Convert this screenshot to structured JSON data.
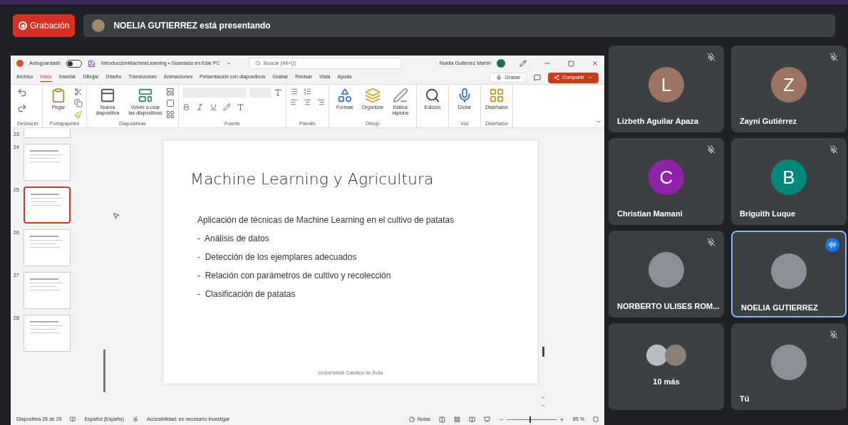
{
  "recording": {
    "label": "Grabación"
  },
  "presenter_bar": {
    "text": "NOELIA GUTIERREZ está presentando"
  },
  "powerpoint": {
    "autosave": {
      "label": "Autoguardado",
      "on": false
    },
    "doc_title": "IntroducciónMachineLearning • Guardado en Este PC",
    "search_placeholder": "Buscar (Alt+Q)",
    "user": "Noelia Gutiérrez Martín",
    "tabs": [
      {
        "label": "Archivo",
        "selected": false
      },
      {
        "label": "Inicio",
        "selected": true
      },
      {
        "label": "Insertar",
        "selected": false
      },
      {
        "label": "Dibujar",
        "selected": false
      },
      {
        "label": "Diseño",
        "selected": false
      },
      {
        "label": "Transiciones",
        "selected": false
      },
      {
        "label": "Animaciones",
        "selected": false
      },
      {
        "label": "Presentación con diapositivos",
        "selected": false
      },
      {
        "label": "Grabar",
        "selected": false
      },
      {
        "label": "Revisar",
        "selected": false
      },
      {
        "label": "Vista",
        "selected": false
      },
      {
        "label": "Ayuda",
        "selected": false
      }
    ],
    "record_button": "Grabar",
    "share_button": "Compartir",
    "ribbon_groups": [
      {
        "label": "Deshacer",
        "kind": "undo"
      },
      {
        "label": "Portapapeles",
        "kind": "clipboard",
        "buttons": [
          "Pegar"
        ]
      },
      {
        "label": "Diapositivas",
        "kind": "slides",
        "buttons": [
          "Nueva diapositiva",
          "Volver a usar las diapositivas"
        ]
      },
      {
        "label": "Fuente",
        "kind": "font"
      },
      {
        "label": "Párrafo",
        "kind": "paragraph"
      },
      {
        "label": "Dibujo",
        "kind": "drawing",
        "buttons": [
          "Formas",
          "Organizar",
          "Estilos rápidos"
        ]
      },
      {
        "kind": "editing",
        "buttons": [
          "Edición"
        ]
      },
      {
        "label": "Voz",
        "kind": "voice",
        "buttons": [
          "Dictar"
        ]
      },
      {
        "label": "Diseñador",
        "kind": "designer",
        "buttons": [
          "Diseñador"
        ]
      }
    ],
    "thumbnails": [
      {
        "number": "23",
        "selected": false
      },
      {
        "number": "24",
        "selected": false
      },
      {
        "number": "25",
        "selected": true
      },
      {
        "number": "26",
        "selected": false
      },
      {
        "number": "27",
        "selected": false
      },
      {
        "number": "28",
        "selected": false
      }
    ],
    "slide": {
      "title": "Machine Learning y Agricultura",
      "subtitle": "Aplicación de técnicas de Machine Learning en el cultivo de patatas",
      "bullets": [
        "-  Análisis de datos",
        "-  Detección de los ejemplares adecuados",
        "-  Relación con parámetros de cultivo y recolección",
        "-  Clasificación de patatas"
      ],
      "footer": "Universidad Católica de Ávila"
    },
    "status_bar": {
      "slide_count": "Diapositiva 25 de 29",
      "language": "Español (España)",
      "accessibility": "Accesibilidad: es necesario investigar",
      "notes": "Notas",
      "zoom": "85 %",
      "zoom_slider": {
        "level": 0.45
      }
    }
  },
  "participants": [
    {
      "name": "Lizbeth Aguilar Apaza",
      "kind": "letter",
      "letter": "L",
      "color": "#9c7461",
      "muted": true,
      "speaking": false
    },
    {
      "name": "Zayni Gutiérrez",
      "kind": "letter",
      "letter": "Z",
      "color": "#9c7461",
      "muted": true,
      "speaking": false
    },
    {
      "name": "Christian Mamani",
      "kind": "letter",
      "letter": "C",
      "color": "#8e24aa",
      "muted": true,
      "speaking": false
    },
    {
      "name": "Briguith Luque",
      "kind": "letter",
      "letter": "B",
      "color": "#00897b",
      "muted": true,
      "speaking": false
    },
    {
      "name": "NORBERTO ULISES ROM...",
      "kind": "photo",
      "muted": true,
      "speaking": false
    },
    {
      "name": "NOELIA GUTIERREZ",
      "kind": "photo",
      "muted": false,
      "speaking": true
    },
    {
      "name": "10 más",
      "kind": "group",
      "muted": false,
      "speaking": false
    },
    {
      "name": "Tú",
      "kind": "photo",
      "muted": true,
      "speaking": false
    }
  ]
}
